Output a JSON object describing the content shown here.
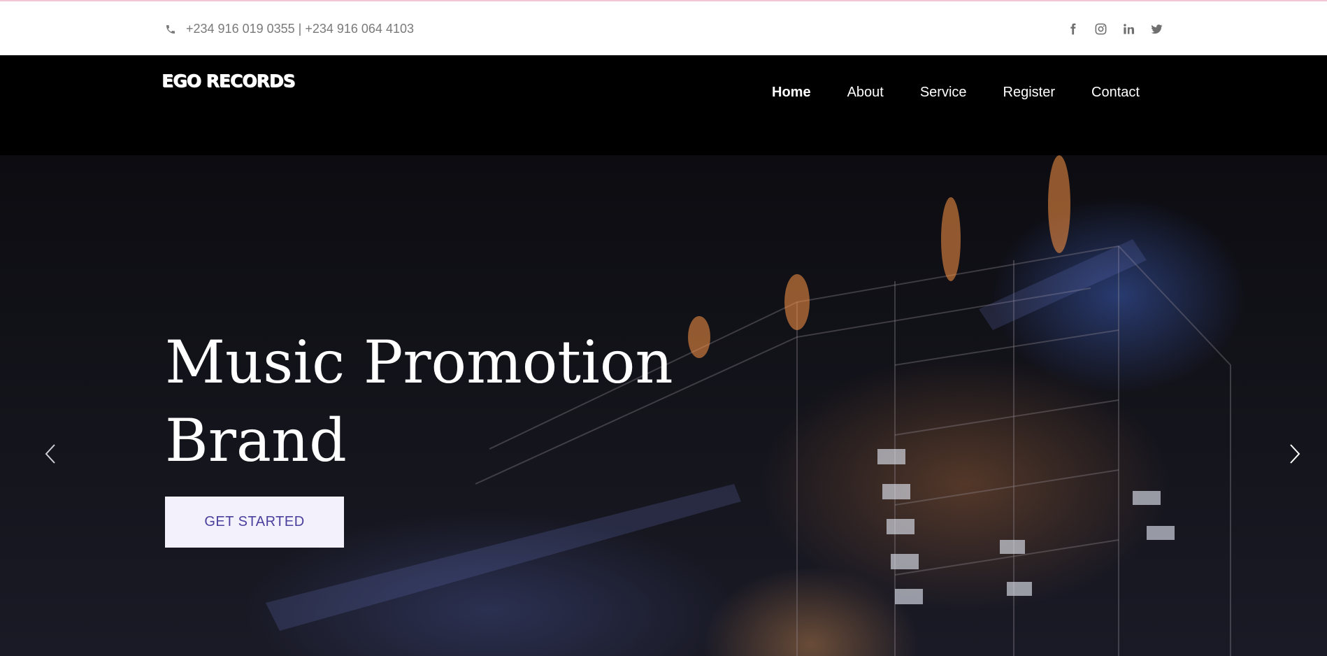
{
  "topbar": {
    "phone_icon": "phone-icon",
    "phone_text": "+234 916 019 0355 | +234 916 064 4103",
    "social": [
      "facebook-icon",
      "instagram-icon",
      "linkedin-icon",
      "twitter-icon"
    ]
  },
  "header": {
    "logo": "EGO RECORDS",
    "nav": [
      {
        "label": "Home",
        "active": true
      },
      {
        "label": "About"
      },
      {
        "label": "Service"
      },
      {
        "label": "Register"
      },
      {
        "label": "Contact"
      }
    ]
  },
  "hero": {
    "title_line1": "Music Promotion",
    "title_line2": "Brand",
    "cta_label": "GET STARTED",
    "prev_icon": "chevron-left-icon",
    "next_icon": "chevron-right-icon"
  },
  "colors": {
    "topbar_bg": "#ffffff",
    "header_bg": "#000000",
    "cta_bg": "#f3f1fb",
    "cta_text": "#4a3f9e",
    "muted_text": "#7a7a7a"
  }
}
